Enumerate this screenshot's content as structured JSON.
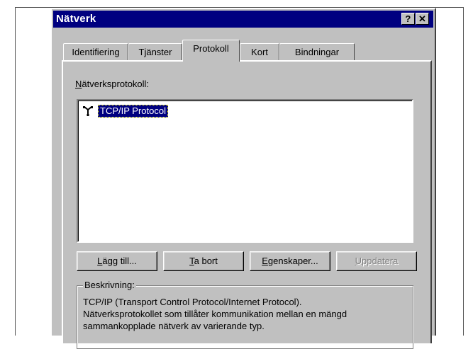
{
  "window": {
    "title": "Nätverk",
    "help_button": "?",
    "close_button": "✕"
  },
  "tabs": [
    {
      "label": "Identifiering",
      "active": false
    },
    {
      "label": "Tjänster",
      "active": false
    },
    {
      "label": "Protokoll",
      "active": true
    },
    {
      "label": "Kort",
      "active": false
    },
    {
      "label": "Bindningar",
      "active": false
    }
  ],
  "protocols": {
    "label_prefix": "N",
    "label_rest": "ätverksprotokoll:",
    "items": [
      {
        "label": "TCP/IP Protocol",
        "icon": "network-protocol-icon",
        "selected": true
      }
    ]
  },
  "buttons": {
    "add": {
      "mnemonic": "L",
      "rest": "ägg till..."
    },
    "remove": {
      "mnemonic": "T",
      "rest": "a bort"
    },
    "properties": {
      "mnemonic": "E",
      "rest": "genskaper..."
    },
    "update": {
      "mnemonic": "U",
      "rest": "ppdatera",
      "disabled": true
    }
  },
  "description": {
    "label": "Beskrivning:",
    "line1": "TCP/IP (Transport Control Protocol/Internet Protocol).",
    "line2": "Nätverksprotokollet som tillåter kommunikation mellan en mängd",
    "line3": "sammankopplade nätverk av varierande typ."
  },
  "colors": {
    "titlebar": "#000080",
    "dialog_face": "#c0c0c0",
    "selection": "#000080"
  }
}
